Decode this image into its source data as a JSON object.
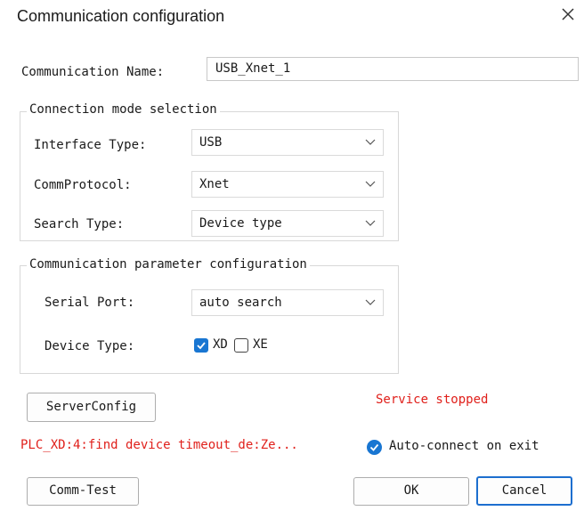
{
  "window": {
    "title": "Communication configuration"
  },
  "comm_name": {
    "label": "Communication Name:",
    "value": "USB_Xnet_1"
  },
  "connection_group": {
    "title": "Connection mode selection",
    "interface_type": {
      "label": "Interface Type:",
      "value": "USB"
    },
    "comm_protocol": {
      "label": "CommProtocol:",
      "value": "Xnet"
    },
    "search_type": {
      "label": "Search Type:",
      "value": "Device type"
    }
  },
  "param_group": {
    "title": "Communication parameter configuration",
    "serial_port": {
      "label": "Serial Port:",
      "value": "auto search"
    },
    "device_type": {
      "label": "Device Type:",
      "options": [
        {
          "label": "XD",
          "checked": true
        },
        {
          "label": "XE",
          "checked": false
        }
      ]
    }
  },
  "server_config_label": "ServerConfig",
  "service_status": "Service stopped",
  "error_message": "PLC_XD:4:find device timeout_de:Ze...",
  "auto_connect": {
    "label": "Auto-connect on exit",
    "checked": true
  },
  "buttons": {
    "comm_test": "Comm-Test",
    "ok": "OK",
    "cancel": "Cancel"
  },
  "colors": {
    "accent": "#1976d2",
    "error_text": "#e0201b",
    "ok_border": "#1d6fcf"
  }
}
